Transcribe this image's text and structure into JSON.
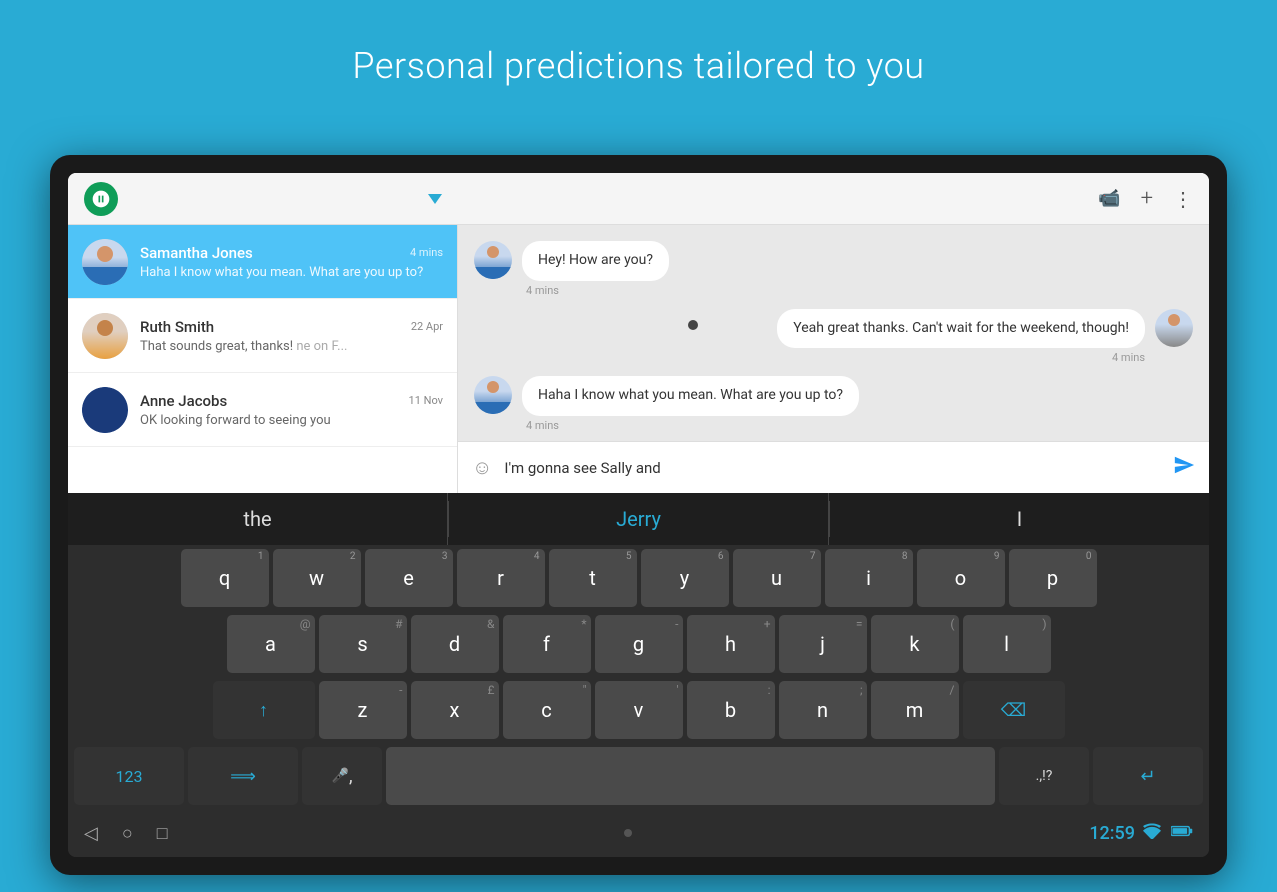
{
  "page": {
    "title": "Personal predictions tailored to you",
    "bg_color": "#29ABD4"
  },
  "topbar": {
    "video_icon": "📹",
    "add_icon": "+",
    "more_icon": "⋮"
  },
  "conversations": [
    {
      "name": "Samantha Jones",
      "preview": "Haha I know what you mean. What are you up to?",
      "time": "4 mins",
      "active": true
    },
    {
      "name": "Ruth Smith",
      "preview": "That sounds great, thanks!",
      "time": "22 Apr",
      "preview2": "ne on F...",
      "active": false
    },
    {
      "name": "Anne Jacobs",
      "preview": "OK looking forward to seeing you",
      "time": "11 Nov",
      "active": false
    }
  ],
  "messages": [
    {
      "text": "Hey! How are you?",
      "time": "4 mins",
      "side": "left"
    },
    {
      "text": "Yeah great thanks. Can't wait for the weekend, though!",
      "time": "4 mins",
      "side": "right"
    },
    {
      "text": "Haha I know what you mean. What are you up to?",
      "time": "4 mins",
      "side": "left"
    }
  ],
  "input": {
    "value": "I'm gonna see Sally and",
    "placeholder": "",
    "emoji_icon": "☺",
    "send_icon": "➤"
  },
  "predictions": [
    {
      "label": "the",
      "highlight": false
    },
    {
      "label": "Jerry",
      "highlight": true
    },
    {
      "label": "I",
      "highlight": false
    }
  ],
  "keyboard": {
    "rows": [
      {
        "keys": [
          {
            "char": "q",
            "num": "1"
          },
          {
            "char": "w",
            "num": "2"
          },
          {
            "char": "e",
            "num": "3"
          },
          {
            "char": "r",
            "num": "4"
          },
          {
            "char": "t",
            "num": "5"
          },
          {
            "char": "y",
            "num": "6"
          },
          {
            "char": "u",
            "num": "7"
          },
          {
            "char": "i",
            "num": "8"
          },
          {
            "char": "o",
            "num": "9"
          },
          {
            "char": "p",
            "num": "0"
          }
        ]
      },
      {
        "keys": [
          {
            "char": "a",
            "sub": "@"
          },
          {
            "char": "s",
            "sub": "#"
          },
          {
            "char": "d",
            "sub": "&"
          },
          {
            "char": "f",
            "sub": "*"
          },
          {
            "char": "g",
            "sub": "-"
          },
          {
            "char": "h",
            "sub": "+"
          },
          {
            "char": "j",
            "sub": "="
          },
          {
            "char": "k",
            "sub": "("
          },
          {
            "char": "l",
            "sub": ")"
          }
        ]
      },
      {
        "keys": [
          {
            "char": "z",
            "sub": "-",
            "special": "shift"
          },
          {
            "char": "x",
            "sub": "£"
          },
          {
            "char": "c",
            "sub": "\""
          },
          {
            "char": "v",
            "sub": "'"
          },
          {
            "char": "b",
            "sub": ":"
          },
          {
            "char": "n",
            "sub": ";"
          },
          {
            "char": "m",
            "sub": "/"
          },
          {
            "char": "⌫",
            "special": "backspace"
          }
        ]
      },
      {
        "keys": [
          {
            "char": "123",
            "special": "num"
          },
          {
            "char": "🌐",
            "special": "lang"
          },
          {
            "char": ",",
            "special": "comma"
          },
          {
            "char": "",
            "special": "space"
          },
          {
            "char": ".,!?",
            "special": "punct"
          },
          {
            "char": "↵",
            "special": "enter"
          }
        ]
      }
    ],
    "shift_icon": "↑",
    "backspace_icon": "⌫",
    "enter_icon": "↵"
  },
  "system_bar": {
    "time": "12:59",
    "wifi_icon": "wifi",
    "battery_icon": "battery",
    "back_icon": "◁",
    "home_icon": "○",
    "recent_icon": "□"
  }
}
